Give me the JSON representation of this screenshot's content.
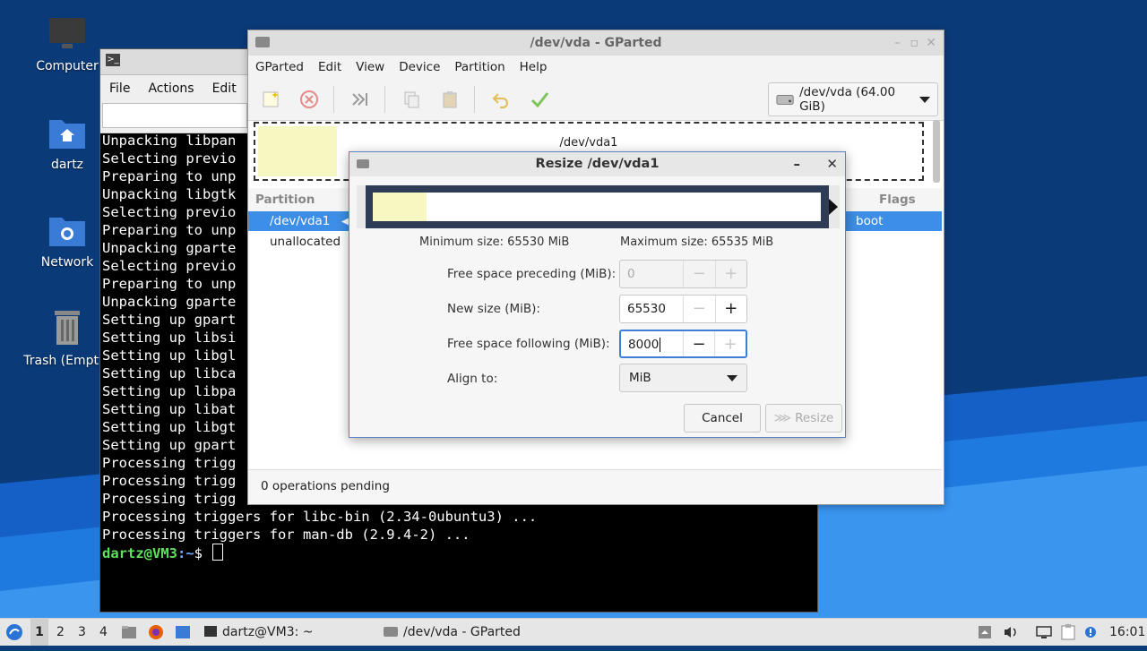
{
  "desktop": {
    "icons": [
      {
        "label": "Computer",
        "icon": "monitor-icon"
      },
      {
        "label": "dartz",
        "icon": "home-folder-icon"
      },
      {
        "label": "Network",
        "icon": "network-folder-icon"
      },
      {
        "label": "Trash (Empty)",
        "icon": "trash-icon"
      }
    ]
  },
  "terminal": {
    "menu": [
      "File",
      "Actions",
      "Edit"
    ],
    "lines": [
      "Unpacking libpan",
      "Selecting previo",
      "Preparing to unp",
      "Unpacking libgtk",
      "Selecting previo",
      "Preparing to unp",
      "Unpacking gparte",
      "Selecting previo",
      "Preparing to unp",
      "Unpacking gparte",
      "Setting up gpart",
      "Setting up libsi",
      "Setting up libgl",
      "Setting up libca",
      "Setting up libpa",
      "Setting up libat",
      "Setting up libgt",
      "Setting up gpart",
      "Processing trigg",
      "Processing trigg",
      "Processing trigg",
      "Processing triggers for libc-bin (2.34-0ubuntu3) ...",
      "Processing triggers for man-db (2.9.4-2) ..."
    ],
    "prompt_user": "dartz@VM3",
    "prompt_path": ":~",
    "prompt_symbol": "$ "
  },
  "gparted": {
    "title": "/dev/vda - GParted",
    "menu": [
      "GParted",
      "Edit",
      "View",
      "Device",
      "Partition",
      "Help"
    ],
    "device_select": "/dev/vda (64.00 GiB)",
    "disk_map_label": "/dev/vda1",
    "columns": {
      "partition": "Partition",
      "flags": "Flags"
    },
    "rows": [
      {
        "partition": "/dev/vda1",
        "flags": "boot",
        "selected": true
      },
      {
        "partition": "unallocated",
        "flags": "",
        "selected": false
      }
    ],
    "status": "0 operations pending"
  },
  "resize_dialog": {
    "title": "Resize /dev/vda1",
    "min_size": "Minimum size: 65530 MiB",
    "max_size": "Maximum size: 65535 MiB",
    "free_preceding_label": "Free space preceding (MiB):",
    "free_preceding_value": "0",
    "new_size_label": "New size (MiB):",
    "new_size_value": "65530",
    "free_following_label": "Free space following (MiB):",
    "free_following_value": "8000",
    "align_label": "Align to:",
    "align_value": "MiB",
    "cancel": "Cancel",
    "resize": "Resize"
  },
  "taskbar": {
    "workspaces": [
      "1",
      "2",
      "3",
      "4"
    ],
    "tasks": [
      "dartz@VM3: ~",
      "/dev/vda - GParted"
    ],
    "clock": "16:01"
  },
  "colors": {
    "selection": "#3d8ee6",
    "used_space": "#f7f7c2",
    "focus": "#3d7fd6",
    "prompt_user": "#5fe05f",
    "prompt_path": "#6fa8ff"
  }
}
